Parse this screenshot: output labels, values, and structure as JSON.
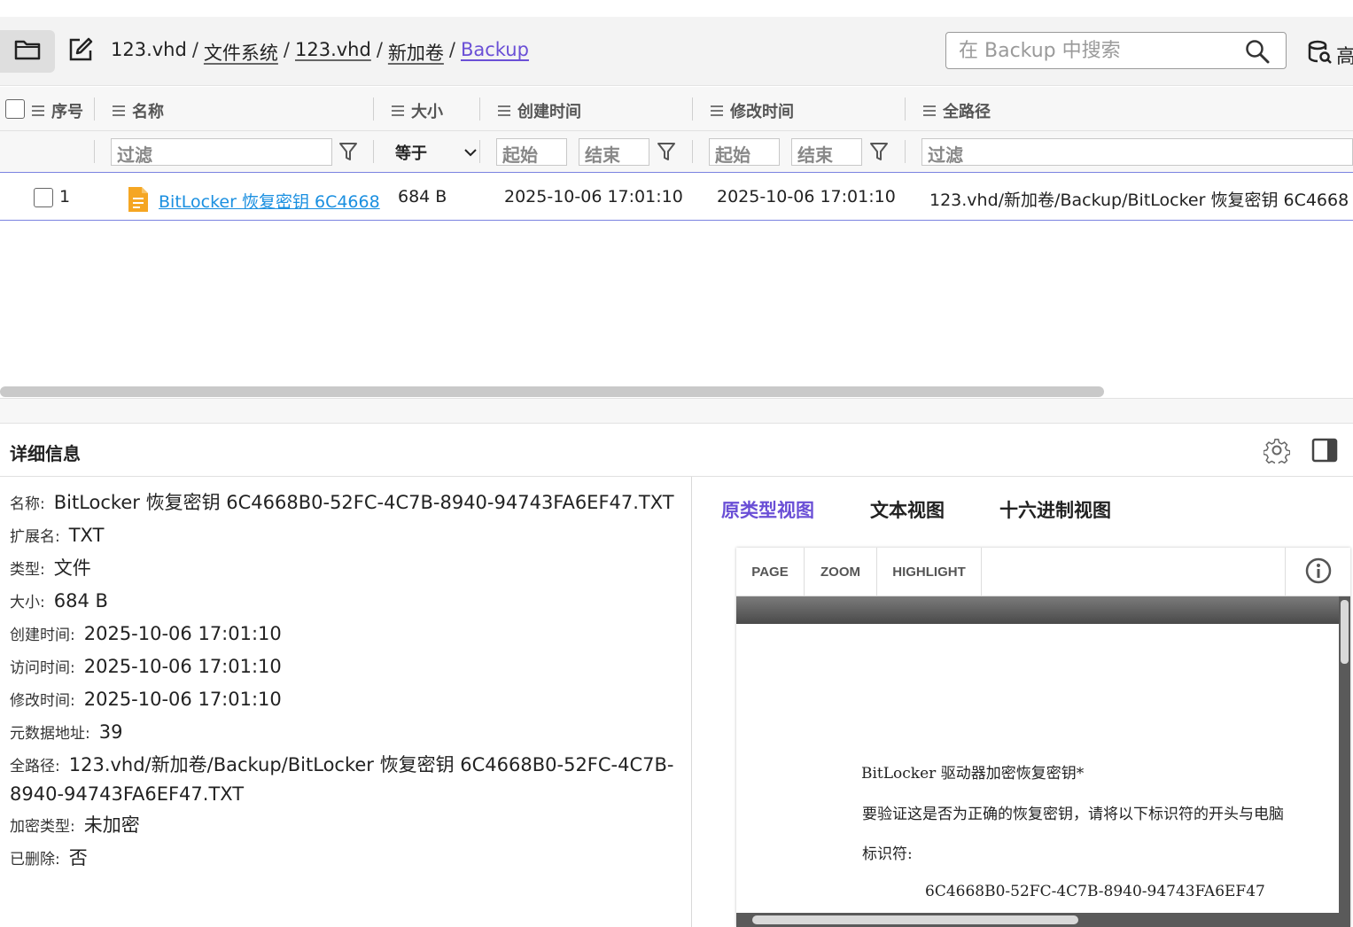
{
  "toolbar": {
    "breadcrumb": [
      "123.vhd",
      "文件系统",
      "123.vhd",
      "新加卷",
      "Backup"
    ],
    "breadcrumb_sep": "/",
    "search_placeholder": "在 Backup 中搜索",
    "advanced_label": "高"
  },
  "grid": {
    "columns": {
      "index": "序号",
      "name": "名称",
      "size": "大小",
      "created": "创建时间",
      "modified": "修改时间",
      "fullpath": "全路径"
    },
    "filters": {
      "name_placeholder": "过滤",
      "size_op": "等于",
      "created_start": "起始",
      "created_end": "结束",
      "modified_start": "起始",
      "modified_end": "结束",
      "fullpath_placeholder": "过滤"
    },
    "rows": [
      {
        "index": "1",
        "name": "BitLocker 恢复密钥 6C4668",
        "size": "684 B",
        "created": "2025-10-06 17:01:10",
        "modified": "2025-10-06 17:01:10",
        "fullpath": "123.vhd/新加卷/Backup/BitLocker 恢复密钥 6C4668"
      }
    ]
  },
  "details": {
    "title": "详细信息",
    "fields": [
      {
        "key": "名称:",
        "value": "BitLocker 恢复密钥 6C4668B0-52FC-4C7B-8940-94743FA6EF47.TXT"
      },
      {
        "key": "扩展名:",
        "value": "TXT"
      },
      {
        "key": "类型:",
        "value": "文件"
      },
      {
        "key": "大小:",
        "value": "684 B"
      },
      {
        "key": "创建时间:",
        "value": "2025-10-06 17:01:10"
      },
      {
        "key": "访问时间:",
        "value": "2025-10-06 17:01:10"
      },
      {
        "key": "修改时间:",
        "value": "2025-10-06 17:01:10"
      },
      {
        "key": "元数据地址:",
        "value": "39"
      },
      {
        "key": "全路径:",
        "value": "123.vhd/新加卷/Backup/BitLocker 恢复密钥 6C4668B0-52FC-4C7B-8940-94743FA6EF47.TXT"
      },
      {
        "key": "加密类型:",
        "value": "未加密"
      },
      {
        "key": "已删除:",
        "value": "否"
      }
    ]
  },
  "preview": {
    "tabs": [
      "原类型视图",
      "文本视图",
      "十六进制视图"
    ],
    "active_tab": 0,
    "viewer_buttons": [
      "PAGE",
      "ZOOM",
      "HIGHLIGHT"
    ],
    "doc_lines": [
      "BitLocker  驱动器加密恢复密钥*",
      "要验证这是否为正确的恢复密钥，请将以下标识符的开头与电脑",
      "标识符:",
      "6C4668B0-52FC-4C7B-8940-94743FA6EF47"
    ]
  },
  "colors": {
    "accent": "#6a4fd6",
    "link": "#1a8fe0",
    "file_icon": "#f5a623",
    "row_border": "#7b83e0"
  }
}
